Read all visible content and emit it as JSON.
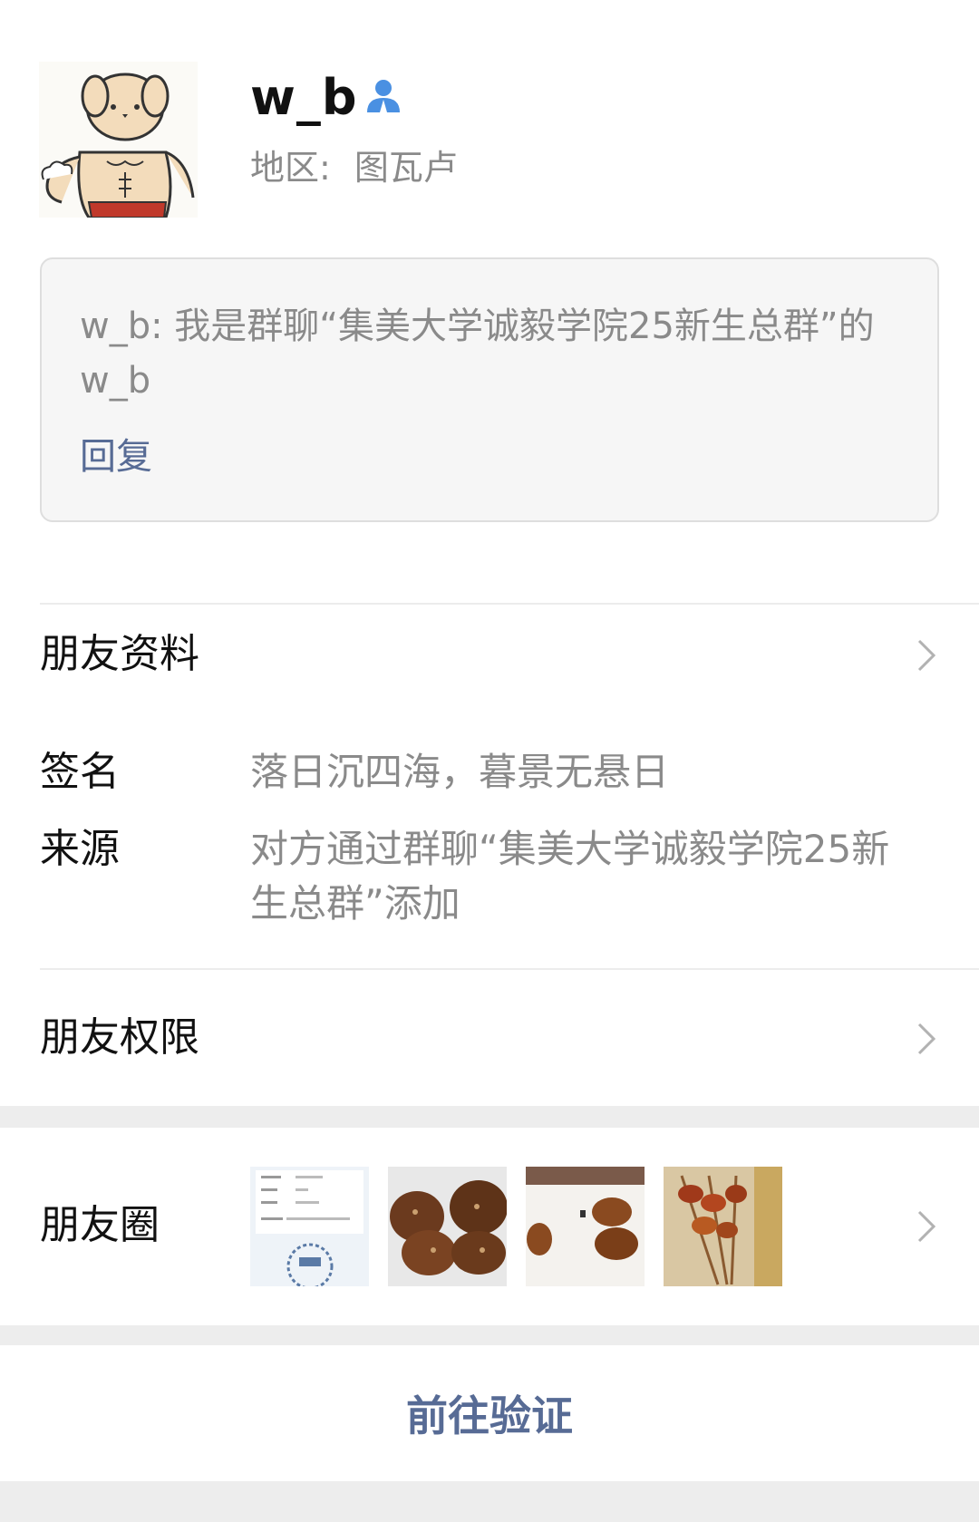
{
  "profile": {
    "nickname": "w_b",
    "region_label": "地区:",
    "region_value": "图瓦卢"
  },
  "verification": {
    "message": "w_b: 我是群聊“集美大学诚毅学院25新生总群”的w_b",
    "reply_label": "回复"
  },
  "friend_info": {
    "title": "朋友资料",
    "signature_label": "签名",
    "signature_value": "落日沉四海，暮景无悬日",
    "source_label": "来源",
    "source_value": "对方通过群聊“集美大学诚毅学院25新生总群”添加"
  },
  "permissions": {
    "title": "朋友权限"
  },
  "moments": {
    "title": "朋友圈"
  },
  "actions": {
    "verify_label": "前往验证"
  },
  "colors": {
    "link": "#576b95",
    "secondary_text": "#8a8a8a",
    "separator": "#ededed",
    "gender_icon": "#4a90e2"
  }
}
